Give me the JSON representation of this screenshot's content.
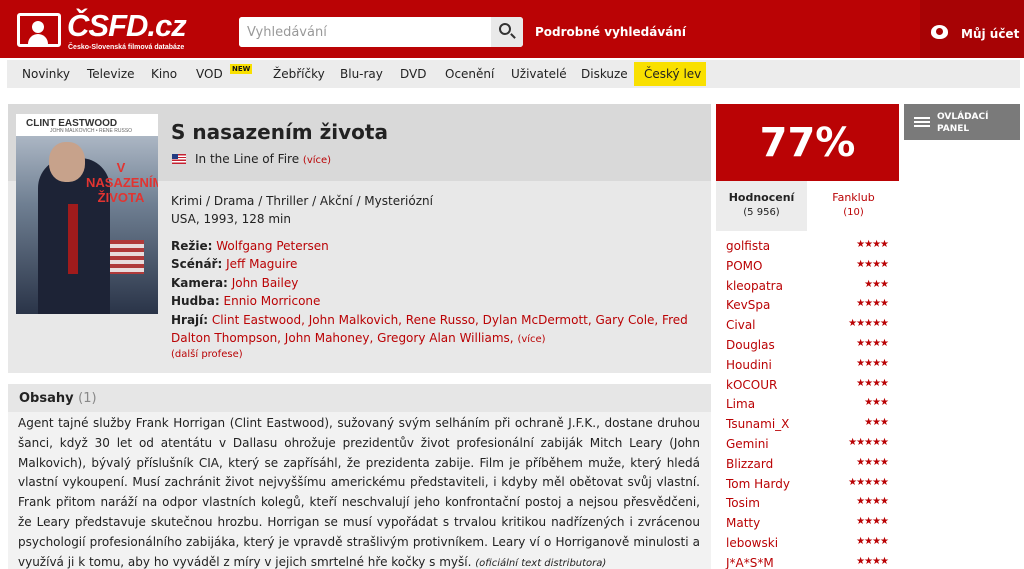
{
  "header": {
    "logo_text": "ČSFD.cz",
    "logo_sub": "Česko-Slovenská filmová databáze",
    "search_placeholder": "Vyhledávání",
    "advanced_search": "Podrobné vyhledávání",
    "account_label": "Můj účet"
  },
  "nav": {
    "items": [
      "Novinky",
      "Televize",
      "Kino",
      "VOD",
      "Žebříčky",
      "Blu-ray",
      "DVD",
      "Ocenění",
      "Uživatelé",
      "Diskuze",
      "Český lev"
    ],
    "vod_badge": "NEW"
  },
  "poster": {
    "name": "CLINT EASTWOOD",
    "cast": "JOHN MALKOVICH • RENE RUSSO",
    "title": "V NASAZENÍM ŽIVOTA"
  },
  "film": {
    "title": "S nasazením života",
    "original_title": "In the Line of Fire",
    "more": "(více)",
    "genres": "Krimi / Drama / Thriller / Akční / Mysteriózní",
    "origin": "USA, 1993, 128 min",
    "director_label": "Režie:",
    "director": "Wolfgang Petersen",
    "writer_label": "Scénář:",
    "writer": "Jeff Maguire",
    "camera_label": "Kamera:",
    "camera": "John Bailey",
    "music_label": "Hudba:",
    "music": "Ennio Morricone",
    "cast_label": "Hrají:",
    "cast": "Clint Eastwood, John Malkovich, Rene Russo, Dylan McDermott, Gary Cole, Fred Dalton Thompson, John Mahoney, Gregory Alan Williams,",
    "cast_more": "(více)",
    "more_professions": "(další profese)"
  },
  "plot": {
    "title": "Obsahy",
    "count": "(1)",
    "text": "Agent tajné služby Frank Horrigan (Clint Eastwood), sužovaný svým selháním při ochraně J.F.K., dostane druhou šanci, když 30 let od atentátu v Dallasu ohrožuje prezidentův život profesionální zabiják Mitch Leary (John Malkovich), bývalý příslušník CIA, který se zapřísáhl, že prezidenta zabije. Film je příběhem muže, který hledá vlastní vykoupení. Musí zachránit život nejvyššímu americkému představiteli, i kdyby měl obětovat svůj vlastní. Frank přitom naráží na odpor vlastních kolegů, kteří neschvalují jeho konfrontační postoj a nejsou přesvědčeni, že Leary představuje skutečnou hrozbu. Horrigan se musí vypořádat s trvalou kritikou nadřízených i zvrácenou psychologií profesionálního zabijáka, který je vpravdě strašlivým protivníkem. Leary ví o Horriganově minulosti a využívá ji k tomu, aby ho vyváděl z míry v jejich smrtelné hře kočky s myší.",
    "source": "(oficiální text distributora)"
  },
  "rating": {
    "score": "77%",
    "tab1_label": "Hodnocení",
    "tab1_count": "(5 956)",
    "tab2_label": "Fanklub",
    "tab2_count": "(10)",
    "users": [
      {
        "name": "golfista",
        "stars": 4
      },
      {
        "name": "POMO",
        "stars": 4
      },
      {
        "name": "kleopatra",
        "stars": 3
      },
      {
        "name": "KevSpa",
        "stars": 4
      },
      {
        "name": "Cival",
        "stars": 5
      },
      {
        "name": "Douglas",
        "stars": 4
      },
      {
        "name": "Houdini",
        "stars": 4
      },
      {
        "name": "kOCOUR",
        "stars": 4
      },
      {
        "name": "Lima",
        "stars": 3
      },
      {
        "name": "Tsunami_X",
        "stars": 3
      },
      {
        "name": "Gemini",
        "stars": 5
      },
      {
        "name": "Blizzard",
        "stars": 4
      },
      {
        "name": "Tom Hardy",
        "stars": 5
      },
      {
        "name": "Tosim",
        "stars": 4
      },
      {
        "name": "Matty",
        "stars": 4
      },
      {
        "name": "lebowski",
        "stars": 4
      },
      {
        "name": "J*A*S*M",
        "stars": 4
      }
    ]
  },
  "control_panel": {
    "label": "OVLÁDACÍ PANEL"
  },
  "colors": {
    "brand_red": "#ba0305",
    "highlight_yellow": "#f9e000"
  }
}
